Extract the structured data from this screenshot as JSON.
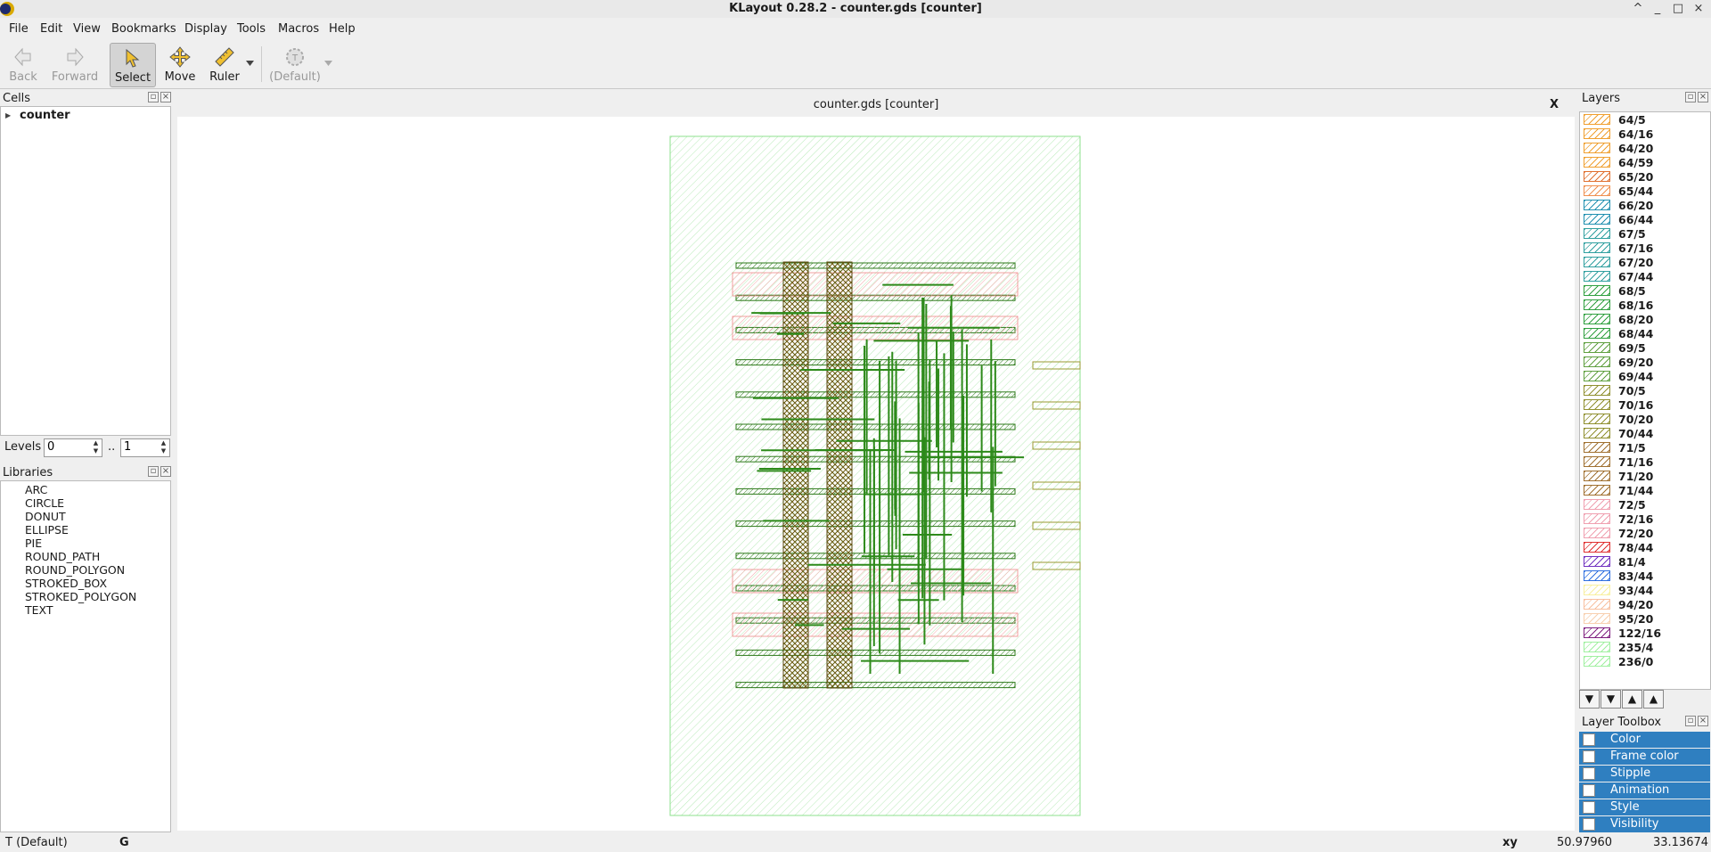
{
  "window": {
    "title": "KLayout 0.28.2 - counter.gds [counter]",
    "controls": [
      "^",
      "_",
      "□",
      "×"
    ]
  },
  "menu": [
    "File",
    "Edit",
    "View",
    "Bookmarks",
    "Display",
    "Tools",
    "Macros",
    "Help"
  ],
  "toolbar": {
    "back": "Back",
    "forward": "Forward",
    "select": "Select",
    "move": "Move",
    "ruler": "Ruler",
    "template": "(Default)"
  },
  "cells": {
    "title": "Cells",
    "items": [
      "counter"
    ]
  },
  "levels": {
    "label": "Levels",
    "from": "0",
    "sep": "..",
    "to": "1"
  },
  "libraries": {
    "title": "Libraries",
    "items": [
      "ARC",
      "CIRCLE",
      "DONUT",
      "ELLIPSE",
      "PIE",
      "ROUND_PATH",
      "ROUND_POLYGON",
      "STROKED_BOX",
      "STROKED_POLYGON",
      "TEXT"
    ]
  },
  "tab": {
    "title": "counter.gds [counter]",
    "close": "X"
  },
  "layers": {
    "title": "Layers",
    "items": [
      {
        "name": "64/5",
        "color": "#f0a030",
        "pattern": "diag"
      },
      {
        "name": "64/16",
        "color": "#f0a030",
        "pattern": "diag"
      },
      {
        "name": "64/20",
        "color": "#f0a030",
        "pattern": "diag"
      },
      {
        "name": "64/59",
        "color": "#f0a030",
        "pattern": "diag"
      },
      {
        "name": "65/20",
        "color": "#e07030",
        "pattern": "diag"
      },
      {
        "name": "65/44",
        "color": "#f09050",
        "pattern": "diag"
      },
      {
        "name": "66/20",
        "color": "#2090b0",
        "pattern": "diag"
      },
      {
        "name": "66/44",
        "color": "#2090b0",
        "pattern": "diag"
      },
      {
        "name": "67/5",
        "color": "#30a0a0",
        "pattern": "diag"
      },
      {
        "name": "67/16",
        "color": "#30a0a0",
        "pattern": "diag"
      },
      {
        "name": "67/20",
        "color": "#30a0a0",
        "pattern": "diag"
      },
      {
        "name": "67/44",
        "color": "#30a0a0",
        "pattern": "diag"
      },
      {
        "name": "68/5",
        "color": "#30a040",
        "pattern": "diag"
      },
      {
        "name": "68/16",
        "color": "#30a040",
        "pattern": "diag"
      },
      {
        "name": "68/20",
        "color": "#30a040",
        "pattern": "diag"
      },
      {
        "name": "68/44",
        "color": "#30a040",
        "pattern": "diag"
      },
      {
        "name": "69/5",
        "color": "#60a040",
        "pattern": "diag"
      },
      {
        "name": "69/20",
        "color": "#60a040",
        "pattern": "diag"
      },
      {
        "name": "69/44",
        "color": "#60a040",
        "pattern": "diag"
      },
      {
        "name": "70/5",
        "color": "#909030",
        "pattern": "diag"
      },
      {
        "name": "70/16",
        "color": "#909030",
        "pattern": "diag"
      },
      {
        "name": "70/20",
        "color": "#909030",
        "pattern": "diag"
      },
      {
        "name": "70/44",
        "color": "#909030",
        "pattern": "diag"
      },
      {
        "name": "71/5",
        "color": "#a07030",
        "pattern": "diag"
      },
      {
        "name": "71/16",
        "color": "#a07030",
        "pattern": "diag"
      },
      {
        "name": "71/20",
        "color": "#a07030",
        "pattern": "diag"
      },
      {
        "name": "71/44",
        "color": "#a07030",
        "pattern": "diag"
      },
      {
        "name": "72/5",
        "color": "#f0a0b0",
        "pattern": "diag"
      },
      {
        "name": "72/16",
        "color": "#f0a0b0",
        "pattern": "diag"
      },
      {
        "name": "72/20",
        "color": "#f0a0b0",
        "pattern": "diag"
      },
      {
        "name": "78/44",
        "color": "#e03030",
        "pattern": "diag"
      },
      {
        "name": "81/4",
        "color": "#7030c0",
        "pattern": "diag"
      },
      {
        "name": "83/44",
        "color": "#3070e0",
        "pattern": "diag"
      },
      {
        "name": "93/44",
        "color": "#f8f0a0",
        "pattern": "diag"
      },
      {
        "name": "94/20",
        "color": "#f8c0a0",
        "pattern": "diag"
      },
      {
        "name": "95/20",
        "color": "#f8d0b0",
        "pattern": "diag"
      },
      {
        "name": "122/16",
        "color": "#802080",
        "pattern": "diag"
      },
      {
        "name": "235/4",
        "color": "#a0f0a0",
        "pattern": "diag"
      },
      {
        "name": "236/0",
        "color": "#a0f0a0",
        "pattern": "diag"
      }
    ]
  },
  "layer_nav": [
    "▼",
    "▼",
    "▲",
    "▲"
  ],
  "layer_toolbox": {
    "title": "Layer Toolbox",
    "items": [
      "Color",
      "Frame color",
      "Stipple",
      "Animation",
      "Style",
      "Visibility"
    ]
  },
  "status": {
    "mode": "T (Default)",
    "grid": "G",
    "xy_label": "xy",
    "x": "50.97960",
    "y": "33.13674"
  }
}
